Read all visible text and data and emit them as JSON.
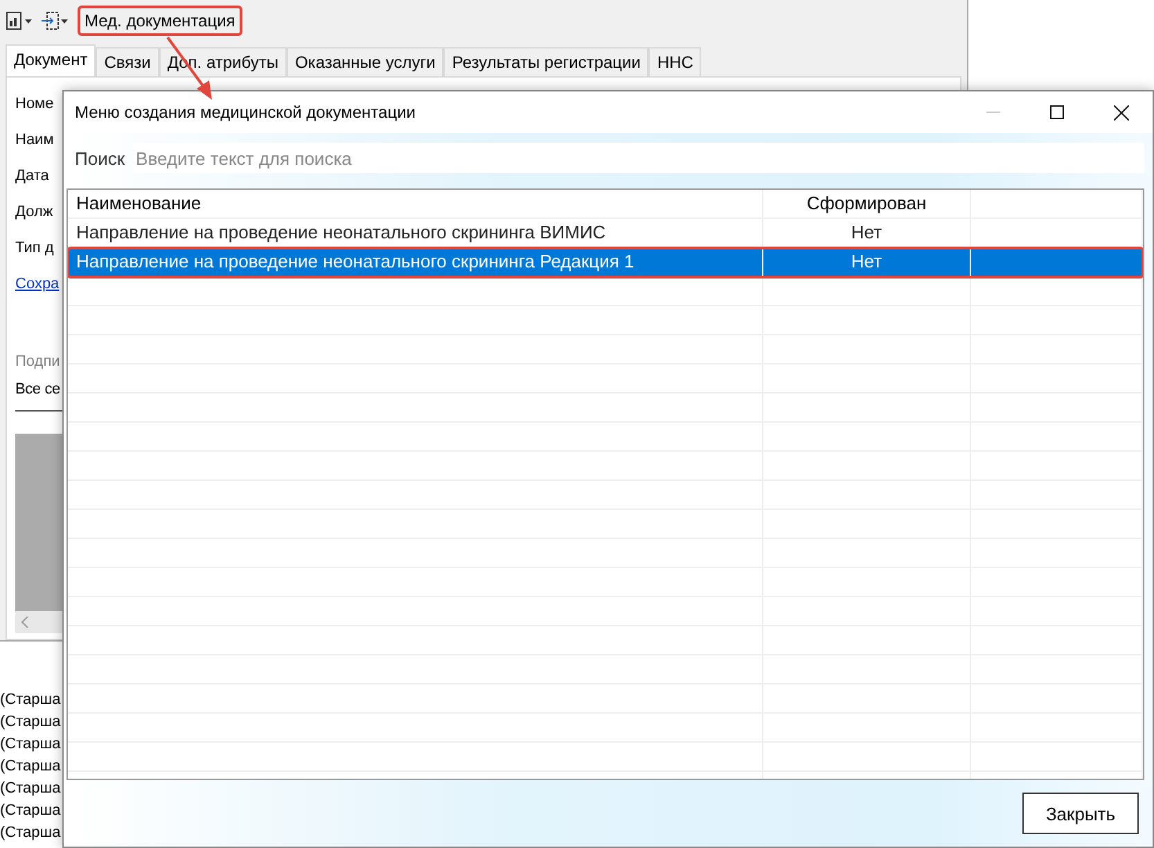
{
  "app": {
    "toolbar": {
      "menu_item": {
        "label": "Мед. документация",
        "highlighted": true
      }
    },
    "tabs": [
      {
        "label": "Документ",
        "selected": true
      },
      {
        "label": "Связи",
        "selected": false
      },
      {
        "label": "Доп. атрибуты",
        "selected": false
      },
      {
        "label": "Оказанные услуги",
        "selected": false
      },
      {
        "label": "Результаты регистрации",
        "selected": false
      },
      {
        "label": "ННС",
        "selected": false
      }
    ],
    "form": {
      "labels": [
        "Номе",
        "Наим",
        "Дата",
        "Долж",
        "Тип д"
      ],
      "link": "Сохра",
      "group_title": "Подпи",
      "group_label": "Все се"
    },
    "background_list": [
      "(Старша",
      "(Старша",
      "(Старша",
      "(Старша",
      "(Старша",
      "(Старша",
      "(Старша"
    ]
  },
  "dialog": {
    "title": "Меню создания медицинской документации",
    "search": {
      "label": "Поиск",
      "placeholder": "Введите текст для поиска"
    },
    "table": {
      "columns": [
        "Наименование",
        "Сформирован"
      ],
      "rows": [
        {
          "name": "Направление на проведение неонатального скрининга ВИМИС",
          "status": "Нет",
          "selected": false,
          "highlighted": false
        },
        {
          "name": "Направление на проведение неонатального скрининга Редакция 1",
          "status": "Нет",
          "selected": true,
          "highlighted": true
        }
      ]
    },
    "buttons": [
      "Закрыть"
    ]
  }
}
